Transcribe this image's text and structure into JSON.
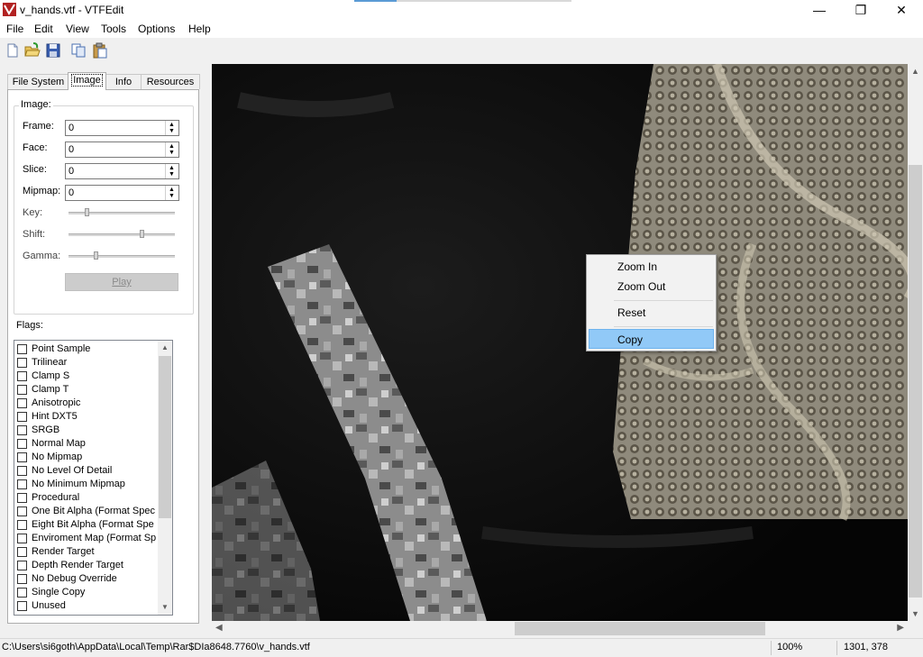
{
  "window": {
    "title": "v_hands.vtf - VTFEdit",
    "minimize": "—",
    "maximize": "❐",
    "close": "✕"
  },
  "menu": [
    "File",
    "Edit",
    "View",
    "Tools",
    "Options",
    "Help"
  ],
  "toolbar": {
    "icons": [
      "new-file-icon",
      "open-folder-icon",
      "save-icon",
      "copy-icon",
      "paste-icon"
    ]
  },
  "tabs": [
    "File System",
    "Image",
    "Info",
    "Resources"
  ],
  "active_tab": "Image",
  "image_group": {
    "label": "Image:",
    "fields": [
      {
        "label": "Frame:",
        "value": "0"
      },
      {
        "label": "Face:",
        "value": "0"
      },
      {
        "label": "Slice:",
        "value": "0"
      },
      {
        "label": "Mipmap:",
        "value": "0"
      }
    ],
    "sliders": [
      {
        "label": "Key:",
        "level": 0.17
      },
      {
        "label": "Shift:",
        "level": 0.69
      },
      {
        "label": "Gamma:",
        "level": 0.25
      }
    ],
    "play_label": "Play"
  },
  "flags_group": {
    "label": "Flags:",
    "items": [
      "Point Sample",
      "Trilinear",
      "Clamp S",
      "Clamp T",
      "Anisotropic",
      "Hint DXT5",
      "SRGB",
      "Normal Map",
      "No Mipmap",
      "No Level Of Detail",
      "No Minimum Mipmap",
      "Procedural",
      "One Bit Alpha (Format Spec",
      "Eight Bit Alpha (Format Spe",
      "Enviroment Map (Format Sp",
      "Render Target",
      "Depth Render Target",
      "No Debug Override",
      "Single Copy",
      "Unused"
    ]
  },
  "context_menu": {
    "items": [
      "Zoom In",
      "Zoom Out",
      "Reset",
      "Copy"
    ],
    "highlighted": "Copy"
  },
  "status": {
    "path": "C:\\Users\\si6goth\\AppData\\Local\\Temp\\Rar$DIa8648.7760\\v_hands.vtf",
    "zoom": "100%",
    "coords": "1301, 378"
  },
  "colors": {
    "highlight": "#91c9f7",
    "accent": "#5b9bd5"
  }
}
